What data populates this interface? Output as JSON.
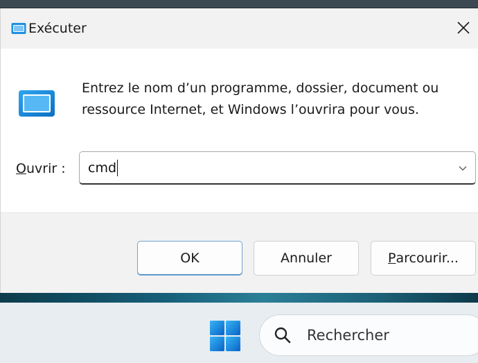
{
  "dialog": {
    "title": "Exécuter",
    "description": "Entrez le nom d’un programme, dossier, document ou ressource Internet, et Windows l’ouvrira pour vous.",
    "open_label_u": "O",
    "open_label_rest": "uvrir :",
    "input_value": "cmd",
    "buttons": {
      "ok": "OK",
      "cancel": "Annuler",
      "browse_u": "P",
      "browse_rest": "arcourir..."
    }
  },
  "taskbar": {
    "search_placeholder": "Rechercher"
  },
  "icons": {
    "title": "run-icon",
    "close": "close-icon",
    "dropdown": "chevron-down-icon",
    "start": "windows-start-icon",
    "search": "search-icon"
  },
  "colors": {
    "accent": "#1a8fd8",
    "windows_blue": "#1e90e0",
    "taskbar_bg": "#e7edf1"
  }
}
